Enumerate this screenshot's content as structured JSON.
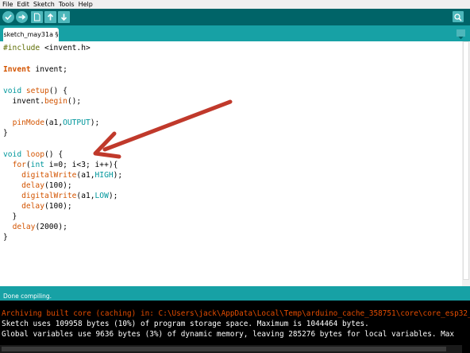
{
  "menu": [
    "File",
    "Edit",
    "Sketch",
    "Tools",
    "Help"
  ],
  "toolbar": {
    "verify": "verify-icon",
    "upload": "upload-icon",
    "new": "new-icon",
    "open": "open-icon",
    "save": "save-icon",
    "serial_monitor": "serial-monitor-icon"
  },
  "tab": {
    "label": "sketch_may31a §"
  },
  "code": [
    "#include <invent.h>",
    "",
    "Invent invent;",
    "",
    "void setup() {",
    "  invent.begin();",
    "",
    "  pinMode(a1,OUTPUT);",
    "}",
    "",
    "void loop() {",
    "  for(int i=0; i<3; i++){",
    "    digitalWrite(a1,HIGH);",
    "    delay(100);",
    "    digitalWrite(a1,LOW);",
    "    delay(100);",
    "  }",
    "  delay(2000);",
    "}"
  ],
  "status": "Done compiling.",
  "console": [
    "Archiving built core (caching) in: C:\\Users\\jack\\AppData\\Local\\Temp\\arduino_cache_358751\\core\\core_esp32_",
    "Sketch uses 109958 bytes (10%) of program storage space. Maximum is 1044464 bytes.",
    "Global variables use 9636 bytes (3%) of dynamic memory, leaving 285276 bytes for local variables. Max"
  ],
  "colors": {
    "toolbar": "#006468",
    "tabbar": "#17a1a5",
    "button": "#4db7bb",
    "arrow": "#c0392b",
    "console_error": "#e34c00"
  }
}
